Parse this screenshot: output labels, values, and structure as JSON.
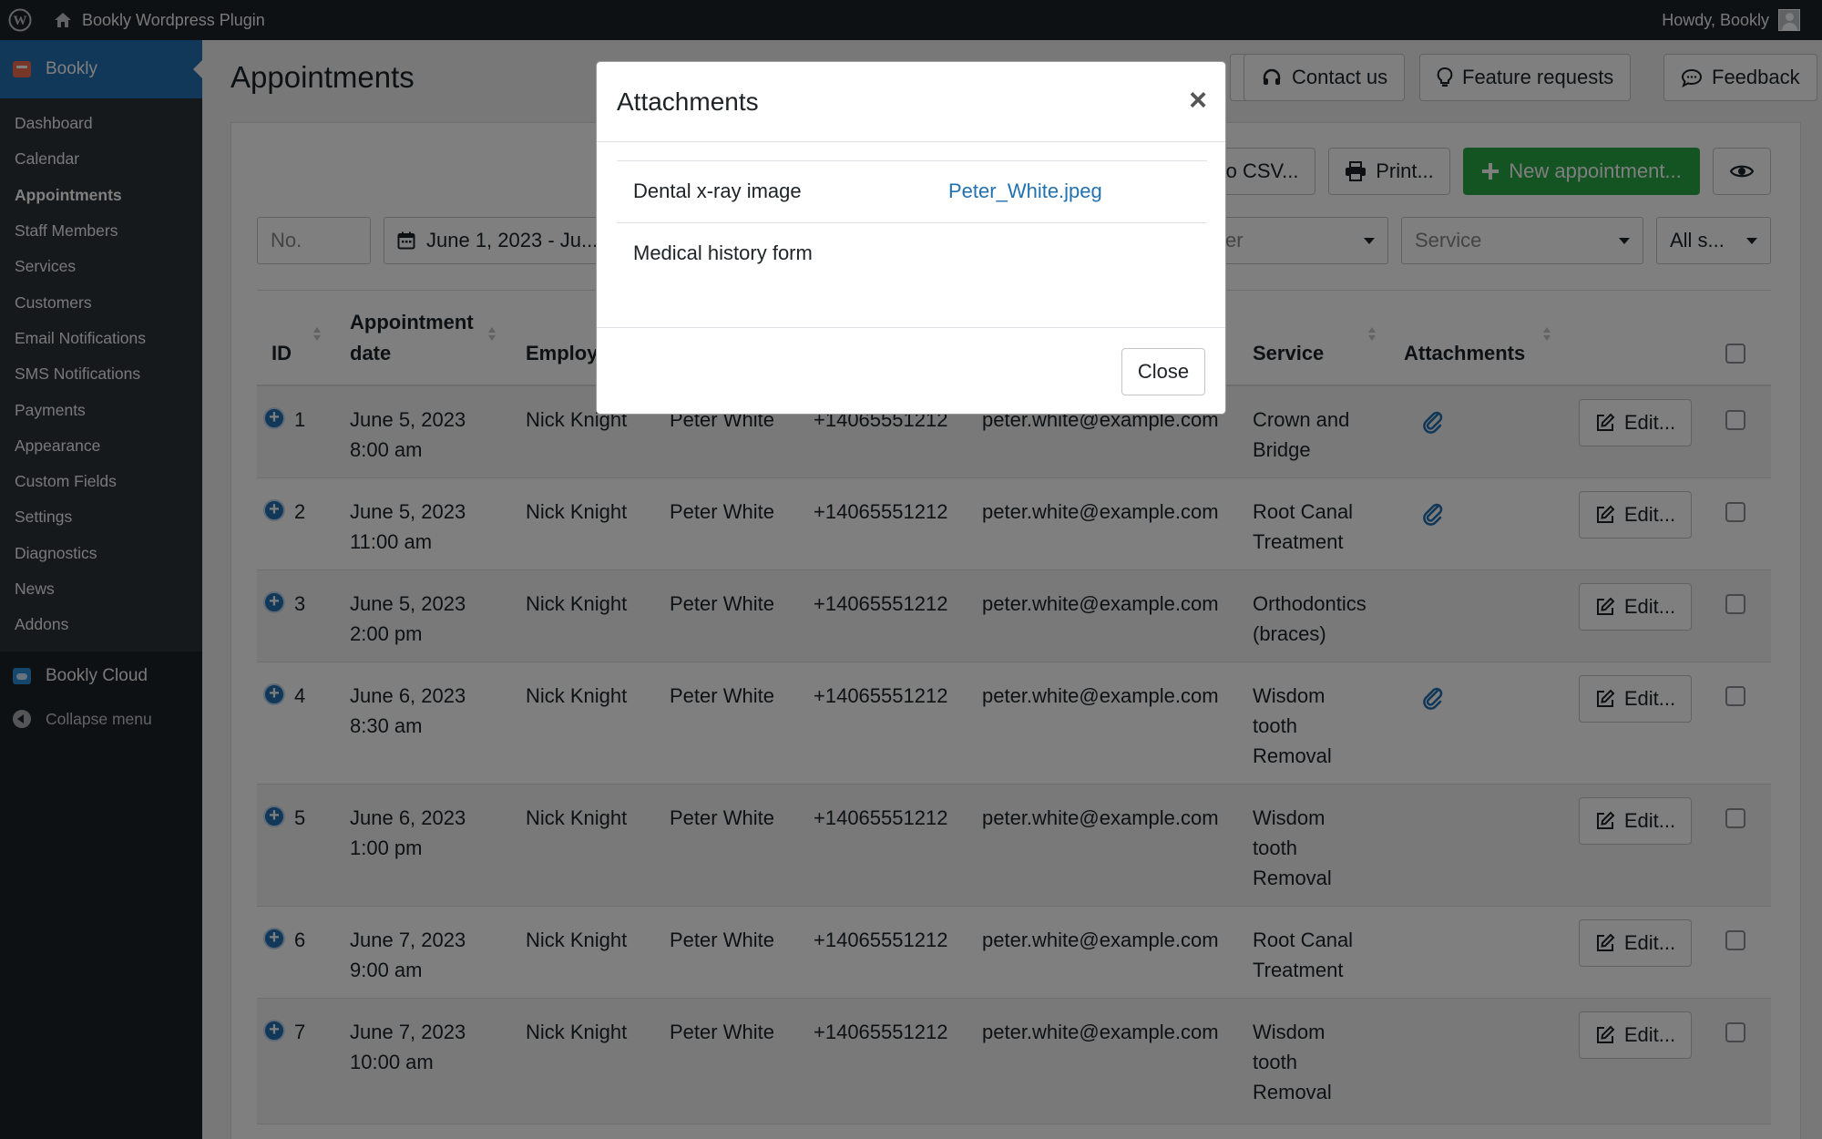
{
  "adminbar": {
    "site_name": "Bookly Wordpress Plugin",
    "howdy": "Howdy, Bookly"
  },
  "sidebar": {
    "top": "Bookly",
    "items": [
      "Dashboard",
      "Calendar",
      "Appointments",
      "Staff Members",
      "Services",
      "Customers",
      "Email Notifications",
      "SMS Notifications",
      "Payments",
      "Appearance",
      "Custom Fields",
      "Settings",
      "Diagnostics",
      "News",
      "Addons"
    ],
    "cloud": "Bookly Cloud",
    "collapse": "Collapse menu"
  },
  "header": {
    "title": "Appointments",
    "buttons": {
      "contact": "Contact us",
      "feature": "Feature requests",
      "feedback": "Feedback"
    }
  },
  "toolbar": {
    "export": "to CSV...",
    "print": "Print...",
    "new": "New appointment..."
  },
  "filters": {
    "no": "No.",
    "date": "June 1, 2023 - Ju...",
    "customer": "er",
    "service": "Service",
    "status": "All s..."
  },
  "table": {
    "headers": {
      "id": "ID",
      "date_line1": "Appointment",
      "date_line2": "date",
      "employee": "Employ",
      "service": "Service",
      "attachments": "Attachments"
    },
    "edit_label": "Edit...",
    "rows": [
      {
        "id": "1",
        "date": "June 5, 2023",
        "time": "8:00 am",
        "employee": "Nick Knight",
        "customer": "Peter White",
        "phone": "+14065551212",
        "email": "peter.white@example.com",
        "service": [
          "Crown and",
          "Bridge"
        ],
        "attach": true
      },
      {
        "id": "2",
        "date": "June 5, 2023",
        "time": "11:00 am",
        "employee": "Nick Knight",
        "customer": "Peter White",
        "phone": "+14065551212",
        "email": "peter.white@example.com",
        "service": [
          "Root Canal",
          "Treatment"
        ],
        "attach": true
      },
      {
        "id": "3",
        "date": "June 5, 2023",
        "time": "2:00 pm",
        "employee": "Nick Knight",
        "customer": "Peter White",
        "phone": "+14065551212",
        "email": "peter.white@example.com",
        "service": [
          "Orthodontics",
          "(braces)"
        ],
        "attach": false
      },
      {
        "id": "4",
        "date": "June 6, 2023",
        "time": "8:30 am",
        "employee": "Nick Knight",
        "customer": "Peter White",
        "phone": "+14065551212",
        "email": "peter.white@example.com",
        "service": [
          "Wisdom",
          "tooth",
          "Removal"
        ],
        "attach": true
      },
      {
        "id": "5",
        "date": "June 6, 2023",
        "time": "1:00 pm",
        "employee": "Nick Knight",
        "customer": "Peter White",
        "phone": "+14065551212",
        "email": "peter.white@example.com",
        "service": [
          "Wisdom",
          "tooth",
          "Removal"
        ],
        "attach": false
      },
      {
        "id": "6",
        "date": "June 7, 2023",
        "time": "9:00 am",
        "employee": "Nick Knight",
        "customer": "Peter White",
        "phone": "+14065551212",
        "email": "peter.white@example.com",
        "service": [
          "Root Canal",
          "Treatment"
        ],
        "attach": false
      },
      {
        "id": "7",
        "date": "June 7, 2023",
        "time": "10:00 am",
        "employee": "Nick Knight",
        "customer": "Peter White",
        "phone": "+14065551212",
        "email": "peter.white@example.com",
        "service": [
          "Wisdom",
          "tooth",
          "Removal"
        ],
        "attach": false
      }
    ]
  },
  "modal": {
    "title": "Attachments",
    "items": [
      {
        "label": "Dental x-ray image",
        "file": "Peter_White.jpeg"
      },
      {
        "label": "Medical history form",
        "file": ""
      }
    ],
    "close": "Close"
  },
  "colors": {
    "wp_dark": "#1d2327",
    "wp_blue": "#2271b1",
    "green": "#28a745"
  }
}
